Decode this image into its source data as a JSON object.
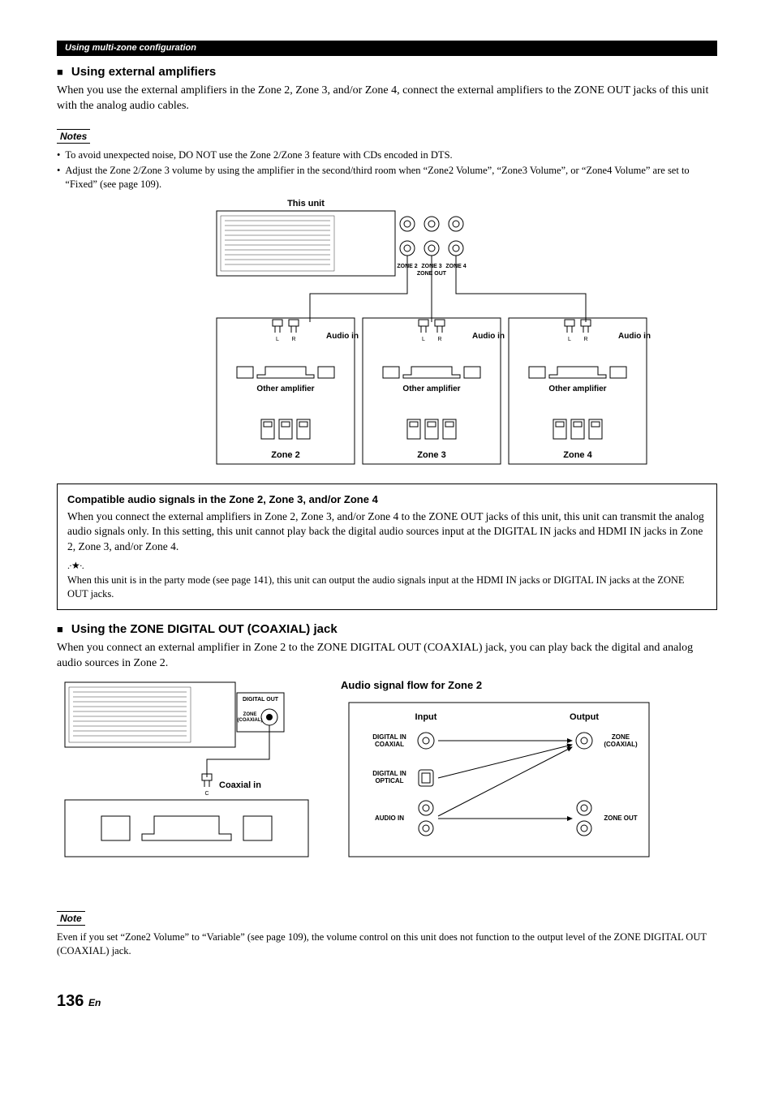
{
  "header": {
    "breadcrumb": "Using multi-zone configuration"
  },
  "section1": {
    "title": "Using external amplifiers",
    "body": "When you use the external amplifiers in the Zone 2, Zone 3, and/or Zone 4, connect the external amplifiers to the ZONE OUT jacks of this unit with the analog audio cables.",
    "notes_label": "Notes",
    "notes": [
      "To avoid unexpected noise, DO NOT use the Zone 2/Zone 3 feature with CDs encoded in DTS.",
      "Adjust the Zone 2/Zone 3 volume by using the amplifier in the second/third room when “Zone2 Volume”, “Zone3 Volume”, or “Zone4 Volume” are set to “Fixed” (see page 109)."
    ]
  },
  "diagram1": {
    "this_unit": "This unit",
    "zone_out": "ZONE OUT",
    "zone2_jack": "ZONE 2",
    "zone3_jack": "ZONE 3",
    "zone4_jack": "ZONE 4",
    "audio_in": "Audio in",
    "other_amp": "Other amplifier",
    "zones": [
      "Zone 2",
      "Zone 3",
      "Zone 4"
    ],
    "lr": {
      "l": "L",
      "r": "R"
    }
  },
  "compat": {
    "title": "Compatible audio signals in the Zone 2, Zone 3, and/or Zone 4",
    "body": "When you connect the external amplifiers in Zone 2, Zone 3, and/or Zone 4 to the ZONE OUT jacks of this unit, this unit can transmit the analog audio signals only. In this setting, this unit cannot play back the digital audio sources input at the DIGITAL IN jacks and HDMI IN jacks in Zone 2, Zone 3, and/or Zone 4.",
    "hint": "When this unit is in the party mode (see page 141), this unit can output the audio signals input at the HDMI IN jacks or DIGITAL IN jacks at the ZONE OUT jacks."
  },
  "section2": {
    "title": "Using the ZONE DIGITAL OUT (COAXIAL) jack",
    "body": "When you connect an external amplifier in Zone 2 to the ZONE DIGITAL OUT (COAXIAL) jack, you can play back the digital and analog audio sources in Zone 2."
  },
  "diagram2": {
    "digital_out": "DIGITAL OUT",
    "zone_coaxial": "ZONE\n(COAXIAL)",
    "coaxial_in": "Coaxial in",
    "c": "C"
  },
  "flow": {
    "title": "Audio signal flow for Zone 2",
    "input": "Input",
    "output": "Output",
    "digital_in_coaxial": "DIGITAL IN\nCOAXIAL",
    "digital_in_optical": "DIGITAL IN\nOPTICAL",
    "audio_in": "AUDIO IN",
    "zone_coaxial": "ZONE\n(COAXIAL)",
    "zone_out": "ZONE OUT"
  },
  "note2": {
    "label": "Note",
    "body": "Even if you set “Zone2 Volume” to “Variable” (see page 109), the volume control on this unit does not function to the output level of the ZONE DIGITAL OUT (COAXIAL) jack."
  },
  "page": {
    "num": "136",
    "lang": "En"
  }
}
